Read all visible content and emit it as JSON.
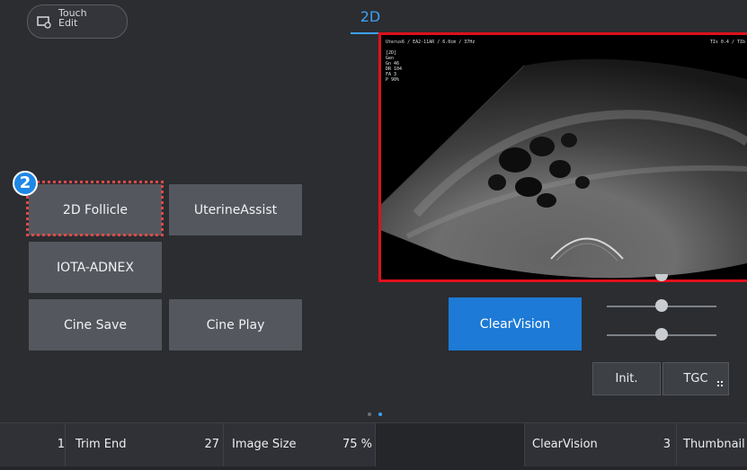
{
  "top": {
    "touch_edit_label_1": "Touch",
    "touch_edit_label_2": "Edit",
    "mode_tab": "2D"
  },
  "badge": "2",
  "buttons": {
    "follicle": "2D Follicle",
    "uterine": "UterineAssist",
    "iota": "IOTA-ADNEX",
    "cine_save": "Cine Save",
    "cine_play": "Cine Play",
    "clearvision": "ClearVision",
    "init": "Init.",
    "tgc": "TGC"
  },
  "image": {
    "header": "Uterus6 / EA2-11AR / 6.0cm / 37Hz",
    "header_right": "TIs 0.4 / TIb",
    "params": [
      "[2D]",
      "Gen",
      "Gn  46",
      "DR  104",
      "FA  3",
      "P   90%"
    ]
  },
  "bottom": {
    "cells": [
      {
        "label": "",
        "value": "1"
      },
      {
        "label": "Trim End",
        "value": "27"
      },
      {
        "label": "Image Size",
        "value": "75 %"
      },
      {
        "label": "",
        "value": ""
      },
      {
        "label": "ClearVision",
        "value": "3"
      },
      {
        "label": "Thumbnail",
        "value": ""
      }
    ]
  },
  "colors": {
    "accent": "#1d7ad6",
    "highlight": "#e0101b",
    "tab_active": "#3f9ff2"
  }
}
